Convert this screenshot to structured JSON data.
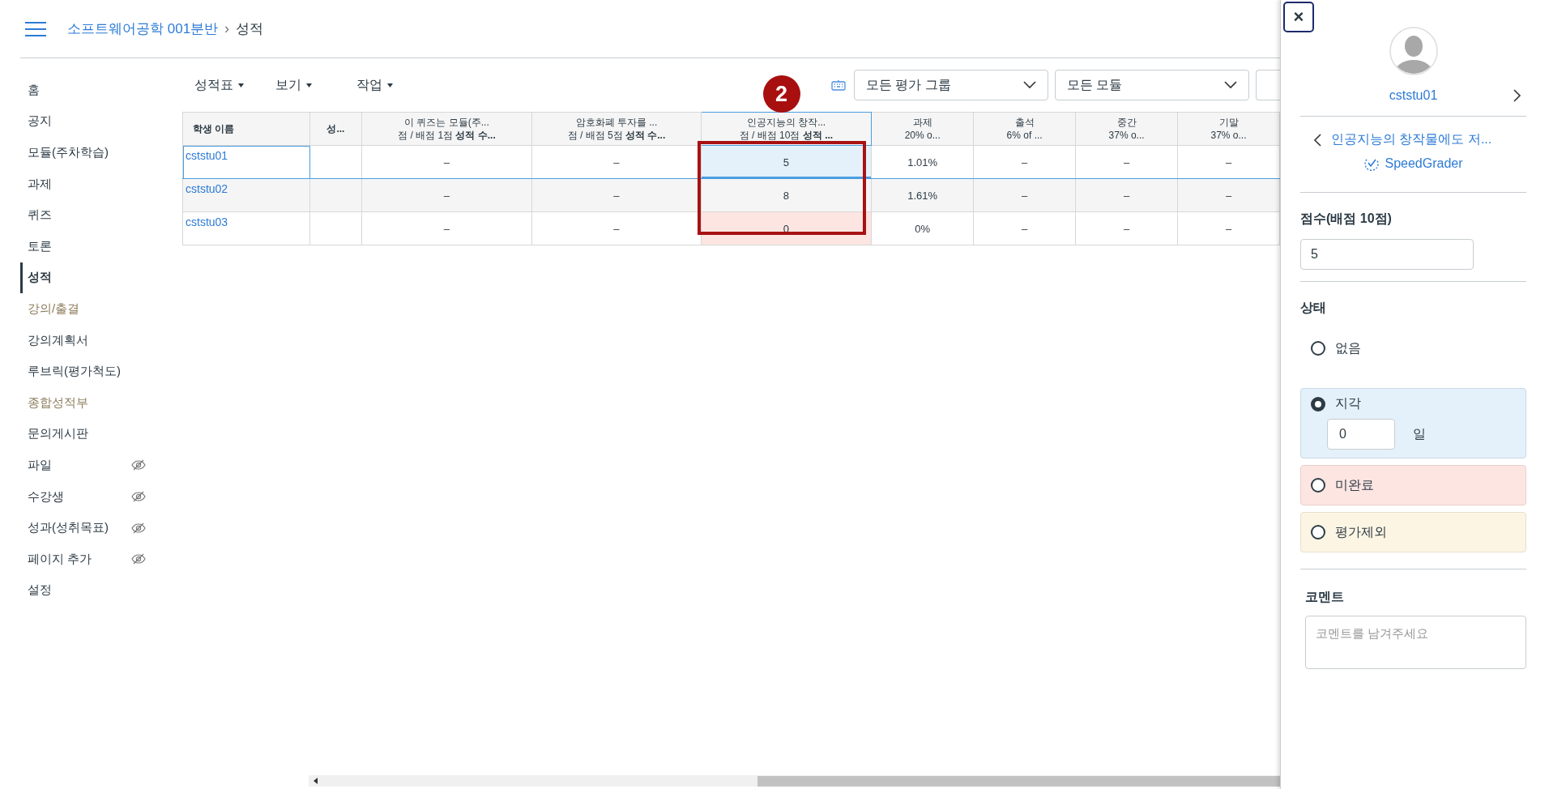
{
  "header": {
    "breadcrumb": [
      {
        "label": "소프트웨어공학 001분반",
        "link": true
      },
      {
        "label": "성적",
        "link": false
      }
    ],
    "separator": "›"
  },
  "sidebar": {
    "items": [
      {
        "label": "홈",
        "selected": false,
        "muted": false,
        "hidden": false
      },
      {
        "label": "공지",
        "selected": false,
        "muted": false,
        "hidden": false
      },
      {
        "label": "모듈(주차학습)",
        "selected": false,
        "muted": false,
        "hidden": false
      },
      {
        "label": "과제",
        "selected": false,
        "muted": false,
        "hidden": false
      },
      {
        "label": "퀴즈",
        "selected": false,
        "muted": false,
        "hidden": false
      },
      {
        "label": "토론",
        "selected": false,
        "muted": false,
        "hidden": false
      },
      {
        "label": "성적",
        "selected": true,
        "muted": false,
        "hidden": false
      },
      {
        "label": "강의/출결",
        "selected": false,
        "muted": true,
        "hidden": false
      },
      {
        "label": "강의계획서",
        "selected": false,
        "muted": false,
        "hidden": false
      },
      {
        "label": "루브릭(평가척도)",
        "selected": false,
        "muted": false,
        "hidden": false
      },
      {
        "label": "종합성적부",
        "selected": false,
        "muted": true,
        "hidden": false
      },
      {
        "label": "문의게시판",
        "selected": false,
        "muted": false,
        "hidden": false
      },
      {
        "label": "파일",
        "selected": false,
        "muted": false,
        "hidden": true
      },
      {
        "label": "수강생",
        "selected": false,
        "muted": false,
        "hidden": true
      },
      {
        "label": "성과(성취목표)",
        "selected": false,
        "muted": false,
        "hidden": true
      },
      {
        "label": "페이지 추가",
        "selected": false,
        "muted": false,
        "hidden": true
      },
      {
        "label": "설정",
        "selected": false,
        "muted": false,
        "hidden": false
      }
    ]
  },
  "toolbar": {
    "menus": [
      "성적표",
      "보기",
      "작업"
    ],
    "filters": [
      {
        "value": "모든 평가 그룹"
      },
      {
        "value": "모든 모듈"
      }
    ]
  },
  "table": {
    "columns": [
      {
        "title": "학생 이름",
        "active": false
      },
      {
        "subtitle": "**성...**",
        "active": false
      },
      {
        "title": "이 퀴즈는 모듈(주...",
        "subtitle": "점 / 배점 1점 **성적 수...**",
        "active": false
      },
      {
        "title": "암호화폐 투자를 ...",
        "subtitle": "점 / 배점 5점 **성적 수...**",
        "active": false
      },
      {
        "title": "인공지능의 창작...",
        "subtitle": "점 / 배점 10점 **성적 ...**",
        "active": true
      },
      {
        "title": "과제",
        "subtitle": "20% o...",
        "active": false
      },
      {
        "title": "출석",
        "subtitle": "6% of ...",
        "active": false
      },
      {
        "title": "중간",
        "subtitle": "37% o...",
        "active": false
      },
      {
        "title": "기말",
        "subtitle": "37% o...",
        "active": false
      }
    ],
    "rows": [
      {
        "selected": true,
        "missing": false,
        "cells": [
          "cststu01",
          "",
          "–",
          "–",
          "5",
          "1.01%",
          "–",
          "–",
          "–"
        ]
      },
      {
        "selected": false,
        "missing": false,
        "cells": [
          "cststu02",
          "",
          "–",
          "–",
          "8",
          "1.61%",
          "–",
          "–",
          "–"
        ]
      },
      {
        "selected": false,
        "missing": true,
        "cells": [
          "cststu03",
          "",
          "–",
          "–",
          "0",
          "0%",
          "–",
          "–",
          "–"
        ]
      }
    ]
  },
  "annotation": {
    "number": "2"
  },
  "panel": {
    "close": "×",
    "student": "cststu01",
    "assignment": "인공지능의 창작물에도 저...",
    "speedgrader": "SpeedGrader",
    "score_label": "점수(배점 10점)",
    "score": "5",
    "status_label": "상태",
    "statuses": [
      {
        "kind": "none",
        "label": "없음",
        "selected": false
      },
      {
        "kind": "late",
        "label": "지각",
        "selected": true,
        "days": "0",
        "unit": "일"
      },
      {
        "kind": "missing",
        "label": "미완료",
        "selected": false
      },
      {
        "kind": "excused",
        "label": "평가제외",
        "selected": false
      }
    ],
    "comment_label": "코멘트",
    "comment_placeholder": "코멘트를 남겨주세요"
  }
}
